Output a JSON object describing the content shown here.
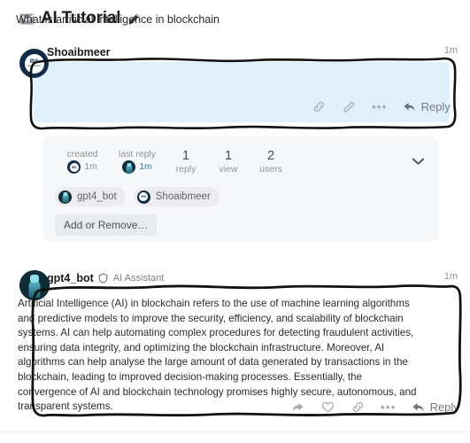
{
  "topic": {
    "title": "AI Tutorial",
    "mail_icon": "mail-icon",
    "edit_icon": "pencil-icon"
  },
  "posts": [
    {
      "username": "Shoaibmeer",
      "user_title": "",
      "timestamp": "1m",
      "body": "What is artificial Intelligence in blockchain",
      "avatar": "shoaibmeer-avatar",
      "actions": {
        "link_label": "link-icon",
        "edit_label": "pencil-icon",
        "more_label": "•••",
        "reply_label": "Reply"
      }
    },
    {
      "username": "gpt4_bot",
      "user_title": "AI Assistant",
      "timestamp": "1m",
      "body": "Artificial Intelligence (AI) in blockchain refers to the use of machine learning algorithms and predictive models to improve the security, efficiency, and scalability of blockchain systems. AI can help automating complex procedures for detecting fraudulent activities, ensuring data integrity, and optimizing the blockchain infrastructure. Moreover, AI algorithms can help analyse the large amount of data generated by transactions in the blockchain, leading to improved decision-making processes. Essentially, the convergence of AI and blockchain technology promises highly secure, autonomous, and transparent systems.",
      "avatar": "gpt4-bot-avatar",
      "actions": {
        "share_label": "share-icon",
        "like_label": "heart-icon",
        "link_label": "link-icon",
        "more_label": "•••",
        "reply_label": "Reply"
      }
    }
  ],
  "stats": {
    "created": {
      "label": "created",
      "value": "1m"
    },
    "last_reply": {
      "label": "last reply",
      "value": "1m"
    },
    "replies": {
      "count": "1",
      "label": "reply"
    },
    "views": {
      "count": "1",
      "label": "view"
    },
    "users": {
      "count": "2",
      "label": "users"
    },
    "collapse_icon": "chevron-down-icon",
    "participants": [
      {
        "name": "gpt4_bot",
        "avatar": "gpt4-bot-avatar"
      },
      {
        "name": "Shoaibmeer",
        "avatar": "shoaibmeer-avatar"
      }
    ],
    "add_remove_label": "Add or Remove…"
  },
  "avatar_seal": {
    "mark": "IBS",
    "sub": "Development"
  },
  "colors": {
    "question_bg": "#dff0fb",
    "panel_bg": "#f6f7f8",
    "link_blue": "#2f80c9",
    "annotation": "#111111"
  }
}
